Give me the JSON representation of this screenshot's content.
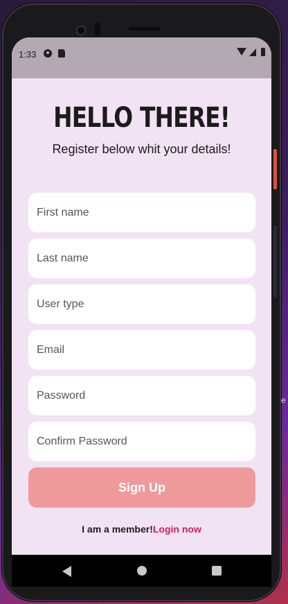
{
  "status_bar": {
    "time": "1:33"
  },
  "header": {
    "title": "HELLO THERE!",
    "subtitle": "Register below whit your details!"
  },
  "form": {
    "fields": [
      {
        "placeholder": "First name"
      },
      {
        "placeholder": "Last name"
      },
      {
        "placeholder": "User type"
      },
      {
        "placeholder": "Email"
      },
      {
        "placeholder": "Password"
      },
      {
        "placeholder": "Confirm Password"
      }
    ],
    "submit_label": "Sign Up"
  },
  "footer": {
    "member_text": "I am a member!",
    "login_link": "Login now"
  },
  "colors": {
    "background": "#f2e3f4",
    "button": "#ee9a9b",
    "link": "#d81b60"
  },
  "icons": [
    "camera-icon",
    "sd-card-icon",
    "wifi-icon",
    "signal-icon",
    "battery-icon",
    "back-icon",
    "home-icon",
    "recents-icon"
  ],
  "edge_text": "e"
}
